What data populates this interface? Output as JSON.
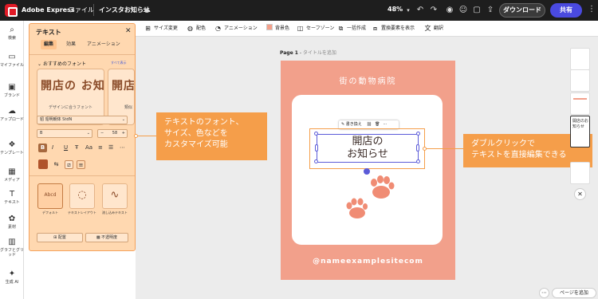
{
  "topbar": {
    "app_name": "Adobe Express",
    "menu_file": "ファイル",
    "doc_title": "インスタお知らせ",
    "zoom": "48%",
    "download": "ダウンロード",
    "share": "共有"
  },
  "rail": {
    "items": [
      {
        "label": "検索",
        "icon": "search-icon"
      },
      {
        "label": "マイファイル",
        "icon": "folder-icon"
      },
      {
        "label": "ブランド",
        "icon": "brand-icon"
      },
      {
        "label": "アップロード",
        "icon": "upload-icon"
      },
      {
        "label": "テンプレート",
        "icon": "template-icon"
      },
      {
        "label": "メディア",
        "icon": "media-icon"
      },
      {
        "label": "テキスト",
        "icon": "text-icon"
      },
      {
        "label": "素材",
        "icon": "elements-icon"
      },
      {
        "label": "グラフとグリッド",
        "icon": "grid-icon"
      },
      {
        "label": "生成 AI",
        "icon": "ai-icon"
      }
    ]
  },
  "context_toolbar": {
    "items": [
      {
        "label": "サイズ変更",
        "icon": "resize-icon"
      },
      {
        "label": "配色",
        "icon": "palette-icon"
      },
      {
        "label": "アニメーション",
        "icon": "animation-icon"
      },
      {
        "label": "背景色",
        "icon": "bg-color-icon"
      },
      {
        "label": "セーフゾーン",
        "icon": "safezone-icon"
      },
      {
        "label": "一括作成",
        "icon": "bulk-icon"
      },
      {
        "label": "置換要素を表示",
        "icon": "replace-icon"
      },
      {
        "label": "翻訳",
        "icon": "translate-icon"
      }
    ]
  },
  "text_panel": {
    "title": "テキスト",
    "tabs": [
      "編集",
      "効果",
      "アニメーション"
    ],
    "section_recommended": "おすすめのフォント",
    "see_all": "すべて表示",
    "font_sample": "開店の お知",
    "font_sample2": "開店",
    "font_caption": "デザインに合うフォント",
    "font_caption2": "類似",
    "font_family": "貂 貂明朝体 StdN",
    "font_weight": "B",
    "font_size": "58",
    "style_cards": [
      {
        "sample": "Abcd",
        "label": "デフォルト"
      },
      {
        "sample": "◌",
        "label": "テキストレイアウト"
      },
      {
        "sample": "∿",
        "label": "流し込みテキスト"
      }
    ],
    "arrange": "配置",
    "opacity": "不透明度"
  },
  "callouts": {
    "left": [
      "テキストのフォント、",
      "サイズ、色などを",
      "カスタマイズ可能"
    ],
    "right": [
      "ダブルクリックで",
      "テキストを直接編集できる"
    ]
  },
  "canvas": {
    "page_label": "Page 1",
    "page_title_placeholder": "タイトルを追加",
    "title": "街の動物病院",
    "text_line1": "開店の",
    "text_line2": "お知らせ",
    "footer": "@nameexamplesitecom",
    "selection_toolbar": "書き換え",
    "page_bg": "#f2a08b"
  },
  "thumbnails": {
    "selected_label": "開店のお知らせ"
  },
  "footer_bar": {
    "add_page": "ページを追加"
  },
  "colors": {
    "accent_orange": "#f59e4a",
    "share_blue": "#4a4ae0",
    "selection_blue": "#5b5bd8"
  }
}
